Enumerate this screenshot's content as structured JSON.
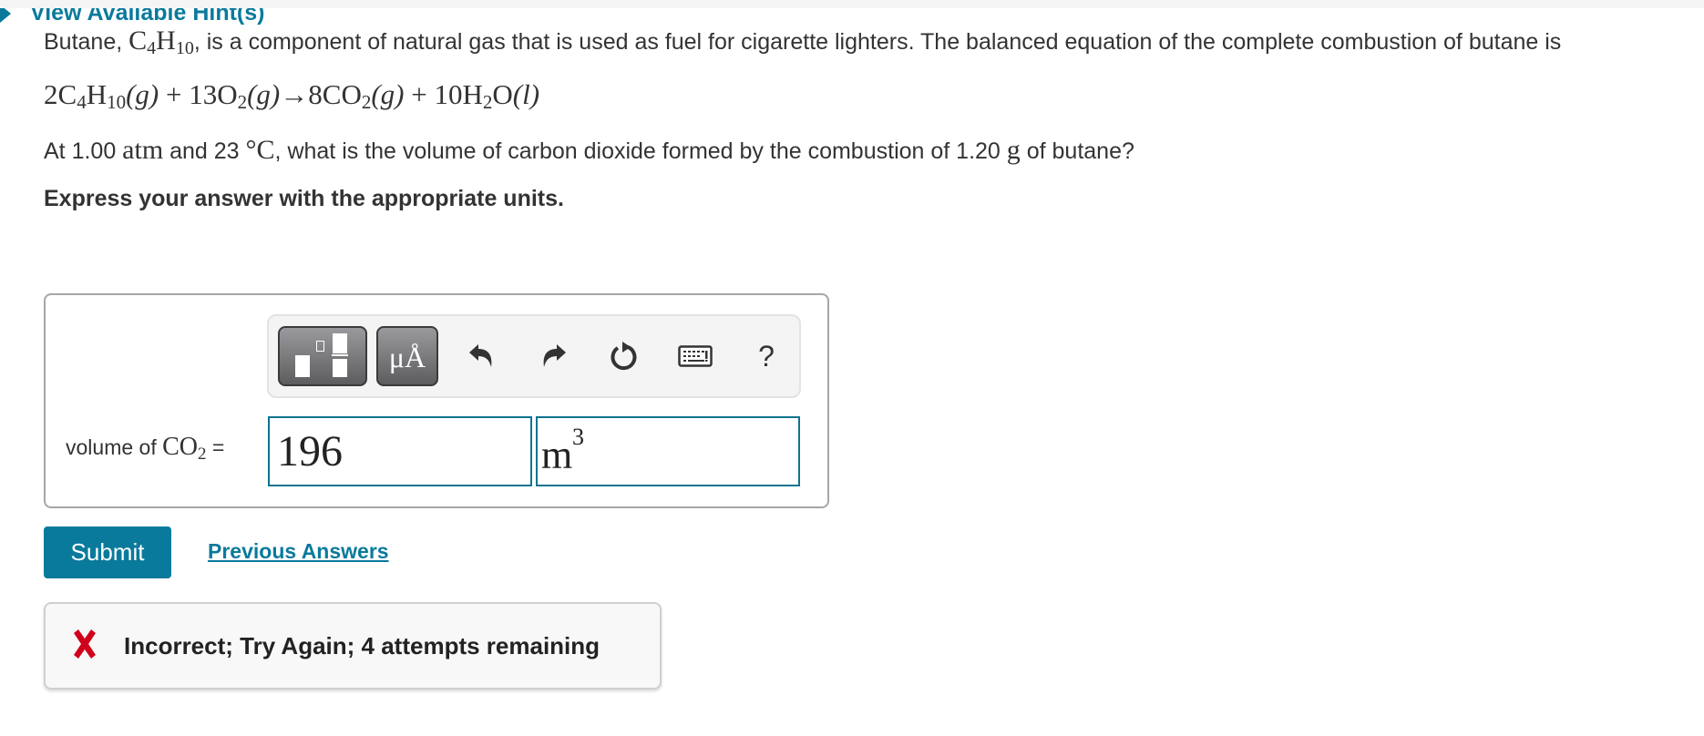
{
  "problem": {
    "intro_prefix": "Butane, ",
    "butane_formula": {
      "c": "C",
      "c_sub": "4",
      "h": "H",
      "h_sub": "10"
    },
    "intro_suffix": ", is a component of natural gas that is used as fuel for cigarette lighters. The balanced equation of the complete combustion of butane is",
    "equation": {
      "r1_coef": "2",
      "r1_c": "C",
      "r1_c_sub": "4",
      "r1_h": "H",
      "r1_h_sub": "10",
      "r1_state": "(g)",
      "plus1": " + ",
      "r2_coef": "13",
      "r2_o": "O",
      "r2_o_sub": "2",
      "r2_state": "(g)",
      "arrow": "→",
      "p1_coef": "8",
      "p1_formula": "CO",
      "p1_sub": "2",
      "p1_state": "(g)",
      "plus2": " + ",
      "p2_coef": "10",
      "p2_h": "H",
      "p2_h_sub": "2",
      "p2_o": "O",
      "p2_state": "(l)"
    },
    "question_parts": {
      "a": "At 1.00 ",
      "pressure_unit": "atm",
      "b": " and 23 ",
      "temp_unit": "°C",
      "c": ", what is the volume of carbon dioxide formed by the combustion of 1.20 ",
      "mass_unit": "g",
      "d": " of butane?"
    },
    "instruction": "Express your answer with the appropriate units.",
    "hint_link": "View Available Hint(s)"
  },
  "toolbar": {
    "buttons": [
      {
        "name": "templates",
        "icon": "fraction-template-icon"
      },
      {
        "name": "units",
        "icon": "units-icon",
        "label": "μÅ"
      },
      {
        "name": "undo",
        "icon": "undo-icon"
      },
      {
        "name": "redo",
        "icon": "redo-icon"
      },
      {
        "name": "reset",
        "icon": "reset-icon"
      },
      {
        "name": "keyboard",
        "icon": "keyboard-icon"
      },
      {
        "name": "help",
        "icon": "help-icon",
        "label": "?"
      }
    ]
  },
  "answer": {
    "label_prefix": "volume of ",
    "label_formula": "CO",
    "label_sub": "2",
    "label_suffix": " =",
    "value": "196",
    "unit": "m",
    "unit_exponent": "3"
  },
  "actions": {
    "submit_label": "Submit",
    "previous_answers_label": "Previous Answers"
  },
  "feedback": {
    "status": "incorrect",
    "icon": "x-mark-icon",
    "message": "Incorrect; Try Again; 4 attempts remaining",
    "color": "#d0021b"
  },
  "colors": {
    "accent": "#0a7a9c",
    "input_border": "#0e7490",
    "text": "#333333"
  }
}
